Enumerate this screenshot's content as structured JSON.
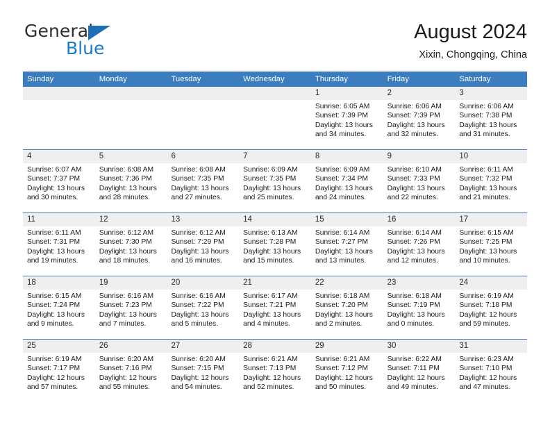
{
  "brand": {
    "word_general": "General",
    "word_blue": "Blue",
    "flag_color": "#1f6fb5",
    "blue_text_color": "#1a7ac4"
  },
  "header": {
    "title": "August 2024",
    "location": "Xixin, Chongqing, China"
  },
  "theme": {
    "header_band": "#3b7dbf",
    "daynum_band": "#efefef",
    "row_divider": "#3b7dbf"
  },
  "calendar": {
    "weekday_headers": [
      "Sunday",
      "Monday",
      "Tuesday",
      "Wednesday",
      "Thursday",
      "Friday",
      "Saturday"
    ],
    "weeks": [
      [
        {
          "day": "",
          "empty": true
        },
        {
          "day": "",
          "empty": true
        },
        {
          "day": "",
          "empty": true
        },
        {
          "day": "",
          "empty": true
        },
        {
          "day": "1",
          "sunrise": "Sunrise: 6:05 AM",
          "sunset": "Sunset: 7:39 PM",
          "daylight1": "Daylight: 13 hours",
          "daylight2": "and 34 minutes."
        },
        {
          "day": "2",
          "sunrise": "Sunrise: 6:06 AM",
          "sunset": "Sunset: 7:39 PM",
          "daylight1": "Daylight: 13 hours",
          "daylight2": "and 32 minutes."
        },
        {
          "day": "3",
          "sunrise": "Sunrise: 6:06 AM",
          "sunset": "Sunset: 7:38 PM",
          "daylight1": "Daylight: 13 hours",
          "daylight2": "and 31 minutes."
        }
      ],
      [
        {
          "day": "4",
          "sunrise": "Sunrise: 6:07 AM",
          "sunset": "Sunset: 7:37 PM",
          "daylight1": "Daylight: 13 hours",
          "daylight2": "and 30 minutes."
        },
        {
          "day": "5",
          "sunrise": "Sunrise: 6:08 AM",
          "sunset": "Sunset: 7:36 PM",
          "daylight1": "Daylight: 13 hours",
          "daylight2": "and 28 minutes."
        },
        {
          "day": "6",
          "sunrise": "Sunrise: 6:08 AM",
          "sunset": "Sunset: 7:35 PM",
          "daylight1": "Daylight: 13 hours",
          "daylight2": "and 27 minutes."
        },
        {
          "day": "7",
          "sunrise": "Sunrise: 6:09 AM",
          "sunset": "Sunset: 7:35 PM",
          "daylight1": "Daylight: 13 hours",
          "daylight2": "and 25 minutes."
        },
        {
          "day": "8",
          "sunrise": "Sunrise: 6:09 AM",
          "sunset": "Sunset: 7:34 PM",
          "daylight1": "Daylight: 13 hours",
          "daylight2": "and 24 minutes."
        },
        {
          "day": "9",
          "sunrise": "Sunrise: 6:10 AM",
          "sunset": "Sunset: 7:33 PM",
          "daylight1": "Daylight: 13 hours",
          "daylight2": "and 22 minutes."
        },
        {
          "day": "10",
          "sunrise": "Sunrise: 6:11 AM",
          "sunset": "Sunset: 7:32 PM",
          "daylight1": "Daylight: 13 hours",
          "daylight2": "and 21 minutes."
        }
      ],
      [
        {
          "day": "11",
          "sunrise": "Sunrise: 6:11 AM",
          "sunset": "Sunset: 7:31 PM",
          "daylight1": "Daylight: 13 hours",
          "daylight2": "and 19 minutes."
        },
        {
          "day": "12",
          "sunrise": "Sunrise: 6:12 AM",
          "sunset": "Sunset: 7:30 PM",
          "daylight1": "Daylight: 13 hours",
          "daylight2": "and 18 minutes."
        },
        {
          "day": "13",
          "sunrise": "Sunrise: 6:12 AM",
          "sunset": "Sunset: 7:29 PM",
          "daylight1": "Daylight: 13 hours",
          "daylight2": "and 16 minutes."
        },
        {
          "day": "14",
          "sunrise": "Sunrise: 6:13 AM",
          "sunset": "Sunset: 7:28 PM",
          "daylight1": "Daylight: 13 hours",
          "daylight2": "and 15 minutes."
        },
        {
          "day": "15",
          "sunrise": "Sunrise: 6:14 AM",
          "sunset": "Sunset: 7:27 PM",
          "daylight1": "Daylight: 13 hours",
          "daylight2": "and 13 minutes."
        },
        {
          "day": "16",
          "sunrise": "Sunrise: 6:14 AM",
          "sunset": "Sunset: 7:26 PM",
          "daylight1": "Daylight: 13 hours",
          "daylight2": "and 12 minutes."
        },
        {
          "day": "17",
          "sunrise": "Sunrise: 6:15 AM",
          "sunset": "Sunset: 7:25 PM",
          "daylight1": "Daylight: 13 hours",
          "daylight2": "and 10 minutes."
        }
      ],
      [
        {
          "day": "18",
          "sunrise": "Sunrise: 6:15 AM",
          "sunset": "Sunset: 7:24 PM",
          "daylight1": "Daylight: 13 hours",
          "daylight2": "and 9 minutes."
        },
        {
          "day": "19",
          "sunrise": "Sunrise: 6:16 AM",
          "sunset": "Sunset: 7:23 PM",
          "daylight1": "Daylight: 13 hours",
          "daylight2": "and 7 minutes."
        },
        {
          "day": "20",
          "sunrise": "Sunrise: 6:16 AM",
          "sunset": "Sunset: 7:22 PM",
          "daylight1": "Daylight: 13 hours",
          "daylight2": "and 5 minutes."
        },
        {
          "day": "21",
          "sunrise": "Sunrise: 6:17 AM",
          "sunset": "Sunset: 7:21 PM",
          "daylight1": "Daylight: 13 hours",
          "daylight2": "and 4 minutes."
        },
        {
          "day": "22",
          "sunrise": "Sunrise: 6:18 AM",
          "sunset": "Sunset: 7:20 PM",
          "daylight1": "Daylight: 13 hours",
          "daylight2": "and 2 minutes."
        },
        {
          "day": "23",
          "sunrise": "Sunrise: 6:18 AM",
          "sunset": "Sunset: 7:19 PM",
          "daylight1": "Daylight: 13 hours",
          "daylight2": "and 0 minutes."
        },
        {
          "day": "24",
          "sunrise": "Sunrise: 6:19 AM",
          "sunset": "Sunset: 7:18 PM",
          "daylight1": "Daylight: 12 hours",
          "daylight2": "and 59 minutes."
        }
      ],
      [
        {
          "day": "25",
          "sunrise": "Sunrise: 6:19 AM",
          "sunset": "Sunset: 7:17 PM",
          "daylight1": "Daylight: 12 hours",
          "daylight2": "and 57 minutes."
        },
        {
          "day": "26",
          "sunrise": "Sunrise: 6:20 AM",
          "sunset": "Sunset: 7:16 PM",
          "daylight1": "Daylight: 12 hours",
          "daylight2": "and 55 minutes."
        },
        {
          "day": "27",
          "sunrise": "Sunrise: 6:20 AM",
          "sunset": "Sunset: 7:15 PM",
          "daylight1": "Daylight: 12 hours",
          "daylight2": "and 54 minutes."
        },
        {
          "day": "28",
          "sunrise": "Sunrise: 6:21 AM",
          "sunset": "Sunset: 7:13 PM",
          "daylight1": "Daylight: 12 hours",
          "daylight2": "and 52 minutes."
        },
        {
          "day": "29",
          "sunrise": "Sunrise: 6:21 AM",
          "sunset": "Sunset: 7:12 PM",
          "daylight1": "Daylight: 12 hours",
          "daylight2": "and 50 minutes."
        },
        {
          "day": "30",
          "sunrise": "Sunrise: 6:22 AM",
          "sunset": "Sunset: 7:11 PM",
          "daylight1": "Daylight: 12 hours",
          "daylight2": "and 49 minutes."
        },
        {
          "day": "31",
          "sunrise": "Sunrise: 6:23 AM",
          "sunset": "Sunset: 7:10 PM",
          "daylight1": "Daylight: 12 hours",
          "daylight2": "and 47 minutes."
        }
      ]
    ]
  }
}
